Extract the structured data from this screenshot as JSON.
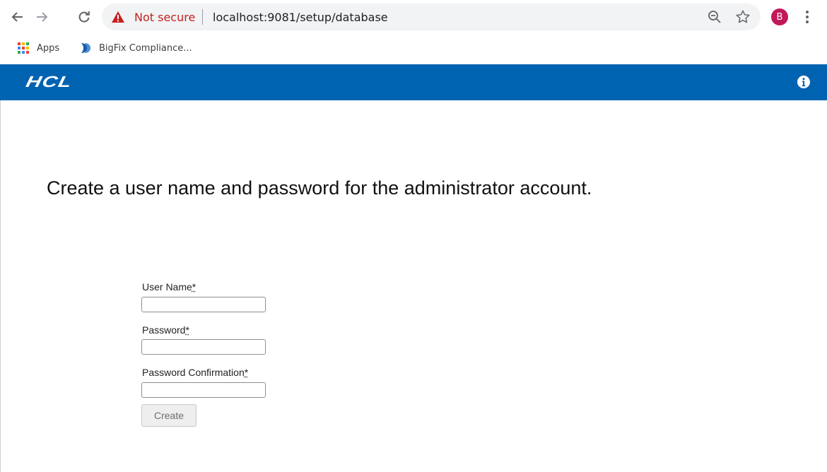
{
  "browser": {
    "security_text": "Not secure",
    "url": "localhost:9081/setup/database",
    "profile_initial": "B",
    "bookmarks": [
      {
        "label": "Apps",
        "icon": "apps-grid-icon"
      },
      {
        "label": "BigFix Compliance...",
        "icon": "bigfix-icon"
      }
    ]
  },
  "app": {
    "logo_text": "HCL",
    "header_color": "#0063b1"
  },
  "form": {
    "heading": "Create a user name and password for the administrator account.",
    "username_label": "User Name",
    "password_label": "Password",
    "confirm_label": "Password Confirmation",
    "required_mark": "*",
    "username_value": "",
    "password_value": "",
    "confirm_value": "",
    "create_label": "Create"
  }
}
